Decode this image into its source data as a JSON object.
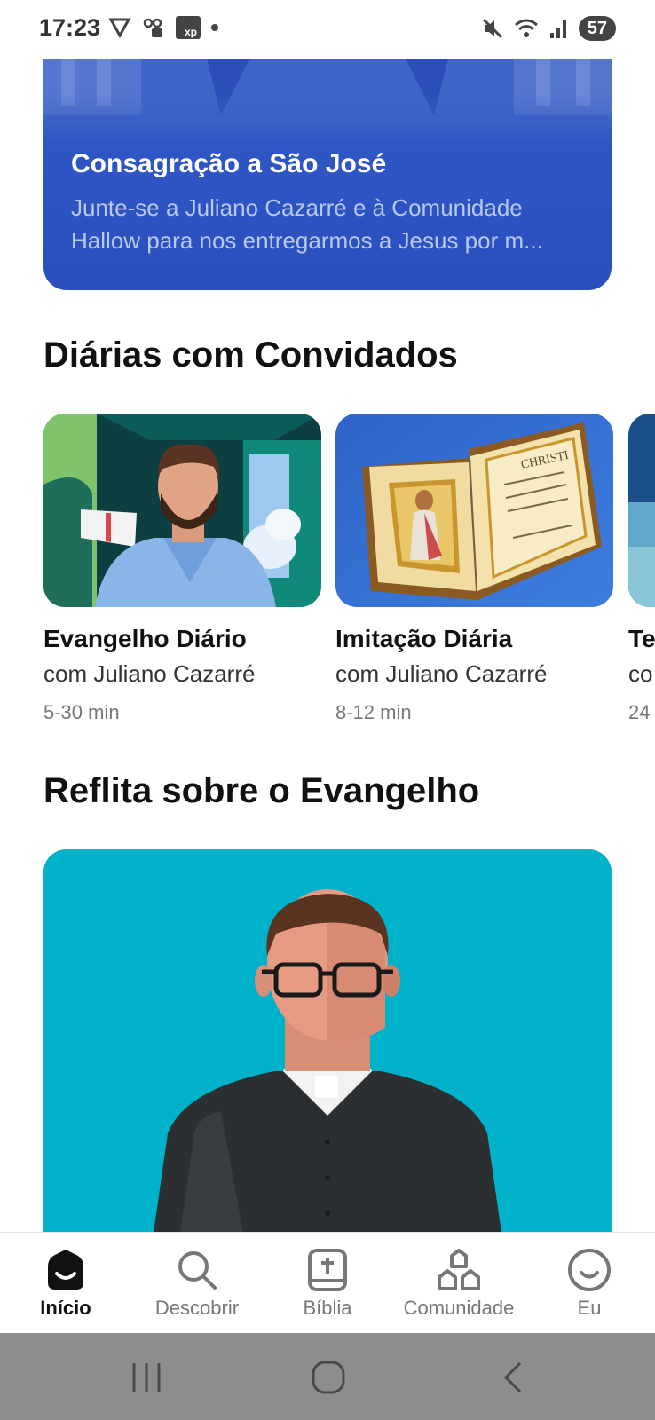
{
  "status": {
    "time": "17:23",
    "battery": "57"
  },
  "hero": {
    "title": "Consagração a São José",
    "desc_line1": "Junte-se a Juliano Cazarré e à Comunidade",
    "desc_line2": "Hallow para nos entregarmos a Jesus por m..."
  },
  "sections": {
    "guests_title": "Diárias com Convidados",
    "gospel_title": "Reflita sobre o Evangelho"
  },
  "cards": [
    {
      "title": "Evangelho Diário",
      "subtitle": "com Juliano Cazarré",
      "meta": "5-30 min"
    },
    {
      "title": "Imitação Diária",
      "subtitle": "com Juliano Cazarré",
      "meta": "8-12 min"
    },
    {
      "title": "Te",
      "subtitle": "co",
      "meta": "24"
    }
  ],
  "book": {
    "heading": "CHRISTI"
  },
  "nav": {
    "items": [
      {
        "label": "Início",
        "icon": "home-icon",
        "active": true
      },
      {
        "label": "Descobrir",
        "icon": "search-icon",
        "active": false
      },
      {
        "label": "Bíblia",
        "icon": "bible-icon",
        "active": false
      },
      {
        "label": "Comunidade",
        "icon": "community-icon",
        "active": false
      },
      {
        "label": "Eu",
        "icon": "profile-icon",
        "active": false
      }
    ]
  },
  "colors": {
    "hero_blue": "#2f57c4",
    "gospel_teal": "#00b1ca",
    "system_nav": "#8d8d8d"
  }
}
